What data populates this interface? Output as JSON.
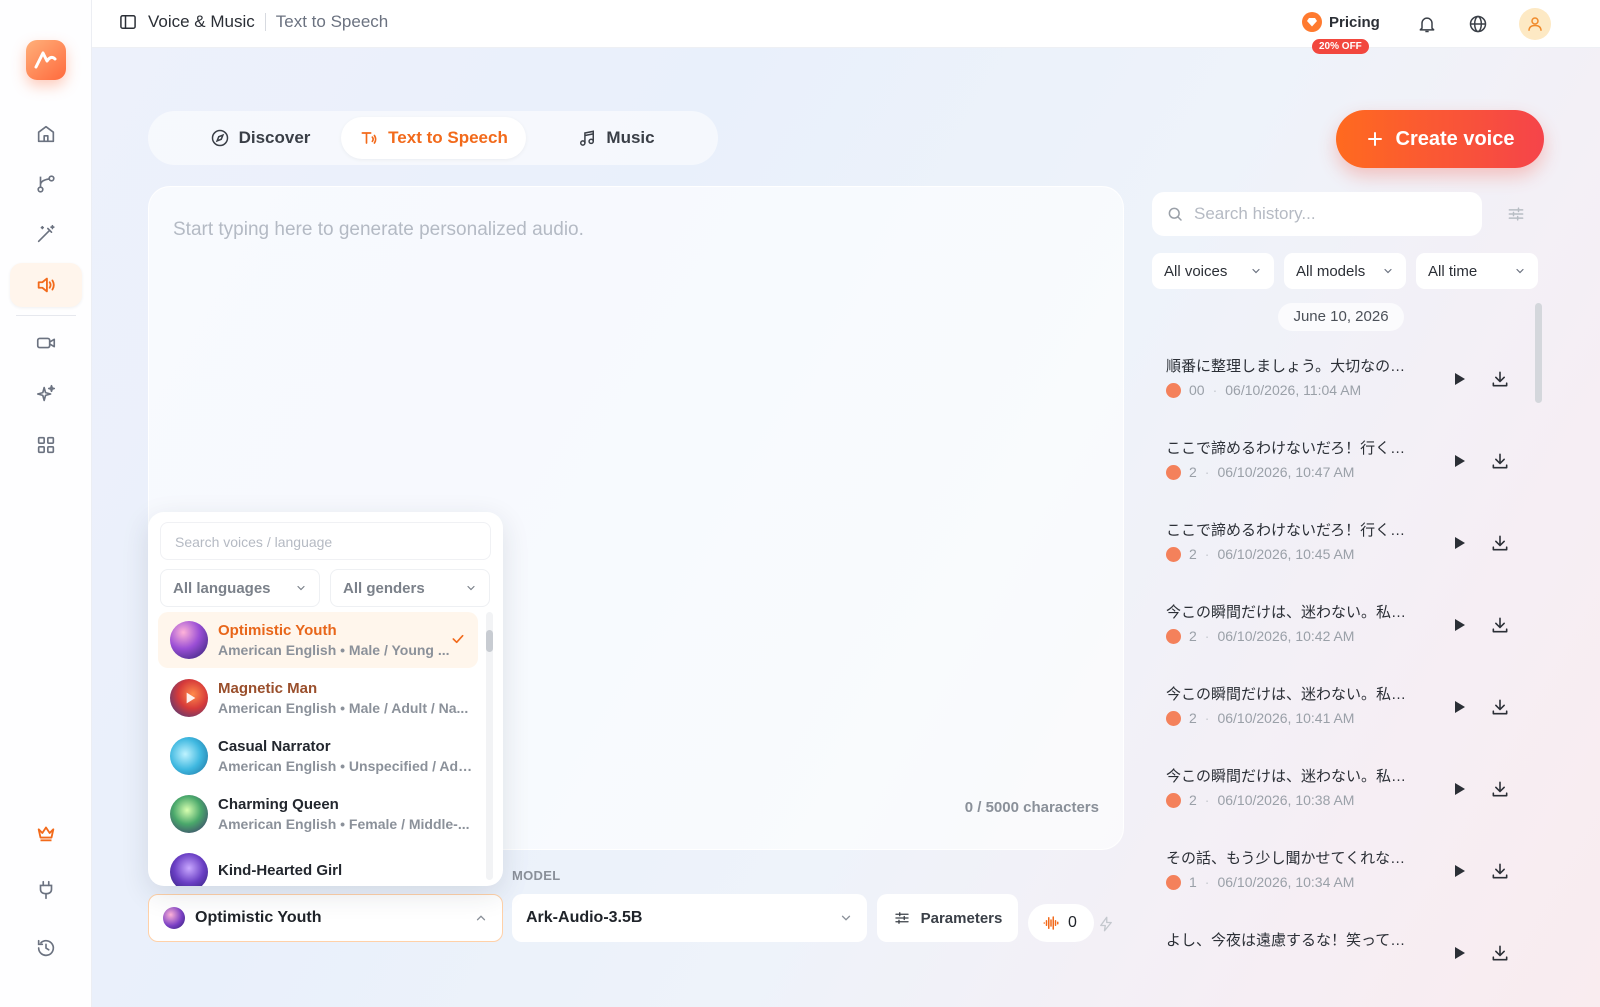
{
  "topbar": {
    "section": "Voice & Music",
    "page": "Text to Speech",
    "pricing_label": "Pricing",
    "discount_badge": "20% OFF"
  },
  "tabs": [
    {
      "label": "Discover",
      "icon": "compass-icon",
      "active": false
    },
    {
      "label": "Text to Speech",
      "icon": "text-to-speech-icon",
      "active": true
    },
    {
      "label": "Music",
      "icon": "music-note-icon",
      "active": false
    }
  ],
  "create_button_label": "Create voice",
  "editor": {
    "placeholder": "Start typing here to generate personalized audio.",
    "char_count": "0 / 5000 characters"
  },
  "voice_picker": {
    "search_placeholder": "Search voices / language",
    "language_filter": "All languages",
    "gender_filter": "All genders",
    "voices": [
      {
        "name": "Optimistic Youth",
        "desc": "American English • Male / Young ...",
        "selected": true
      },
      {
        "name": "Magnetic Man",
        "desc": "American English • Male / Adult / Na...",
        "selected": false
      },
      {
        "name": "Casual Narrator",
        "desc": "American English • Unspecified / Adu...",
        "selected": false
      },
      {
        "name": "Charming Queen",
        "desc": "American English • Female / Middle-...",
        "selected": false
      },
      {
        "name": "Kind-Hearted Girl",
        "desc": "",
        "selected": false
      }
    ]
  },
  "controls": {
    "selected_voice": "Optimistic Youth",
    "model_label": "MODEL",
    "model_value": "Ark-Audio-3.5B",
    "parameters_label": "Parameters",
    "credits": "0"
  },
  "history": {
    "search_placeholder": "Search history...",
    "filters": [
      "All voices",
      "All models",
      "All time"
    ],
    "date_group": "June 10, 2026",
    "items": [
      {
        "text": "順番に整理しましょう。大切なのは、...",
        "count": "00",
        "time": "06/10/2026, 11:04 AM"
      },
      {
        "text": "ここで諦めるわけないだろ！行くぞ！",
        "count": "2",
        "time": "06/10/2026, 10:47 AM"
      },
      {
        "text": "ここで諦めるわけないだろ！行くぞ！",
        "count": "2",
        "time": "06/10/2026, 10:45 AM"
      },
      {
        "text": "今この瞬間だけは、迷わない。私の言...",
        "count": "2",
        "time": "06/10/2026, 10:42 AM"
      },
      {
        "text": "今この瞬間だけは、迷わない。私の言...",
        "count": "2",
        "time": "06/10/2026, 10:41 AM"
      },
      {
        "text": "今この瞬間だけは、迷わない。私の言...",
        "count": "2",
        "time": "06/10/2026, 10:38 AM"
      },
      {
        "text": "その話、もう少し聞かせてくれないか...",
        "count": "1",
        "time": "06/10/2026, 10:34 AM"
      },
      {
        "text": "よし、今夜は遠慮するな！笑って飲ん...",
        "count": "",
        "time": ""
      }
    ]
  },
  "colors": {
    "accent": "#f26a1b",
    "create_gradient_start": "#ff6a1f",
    "create_gradient_end": "#f5444a",
    "history_dot": "#f4815b"
  }
}
